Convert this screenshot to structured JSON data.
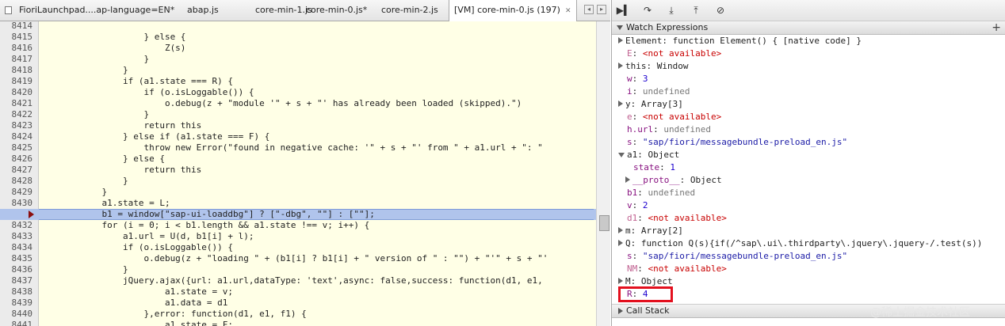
{
  "tabs": [
    {
      "label": "FioriLaunchpad....ap-language=EN*"
    },
    {
      "label": "abap.js"
    },
    {
      "label": "core-min-1.js"
    },
    {
      "label": "core-min-0.js*"
    },
    {
      "label": "core-min-2.js"
    },
    {
      "label": "[VM] core-min-0.js (197)",
      "close": "✕"
    }
  ],
  "editor": {
    "lines": [
      {
        "num": "8414",
        "code": ""
      },
      {
        "num": "8415",
        "code": "                    } else {"
      },
      {
        "num": "8416",
        "code": "                        Z(s)"
      },
      {
        "num": "8417",
        "code": "                    }"
      },
      {
        "num": "8418",
        "code": "                }"
      },
      {
        "num": "8419",
        "code": "                if (a1.state === R) {"
      },
      {
        "num": "8420",
        "code": "                    if (o.isLoggable()) {"
      },
      {
        "num": "8421",
        "code": "                        o.debug(z + \"module '\" + s + \"' has already been loaded (skipped).\")"
      },
      {
        "num": "8422",
        "code": "                    }"
      },
      {
        "num": "8423",
        "code": "                    return this"
      },
      {
        "num": "8424",
        "code": "                } else if (a1.state === F) {"
      },
      {
        "num": "8425",
        "code": "                    throw new Error(\"found in negative cache: '\" + s + \"' from \" + a1.url + \": \""
      },
      {
        "num": "8426",
        "code": "                } else {"
      },
      {
        "num": "8427",
        "code": "                    return this"
      },
      {
        "num": "8428",
        "code": "                }"
      },
      {
        "num": "8429",
        "code": "            }"
      },
      {
        "num": "8430",
        "code": "            a1.state = L;"
      },
      {
        "num": "",
        "code": "            b1 = window[\"sap-ui-loaddbg\"] ? [\"-dbg\", \"\"] : [\"\"];",
        "highlight": true
      },
      {
        "num": "8432",
        "code": "            for (i = 0; i < b1.length && a1.state !== v; i++) {"
      },
      {
        "num": "8433",
        "code": "                a1.url = U(d, b1[i] + l);"
      },
      {
        "num": "8434",
        "code": "                if (o.isLoggable()) {"
      },
      {
        "num": "8435",
        "code": "                    o.debug(z + \"loading \" + (b1[i] ? b1[i] + \" version of \" : \"\") + \"'\" + s + \"'"
      },
      {
        "num": "8436",
        "code": "                }"
      },
      {
        "num": "8437",
        "code": "                jQuery.ajax({url: a1.url,dataType: 'text',async: false,success: function(d1, e1,"
      },
      {
        "num": "8438",
        "code": "                        a1.state = v;"
      },
      {
        "num": "8439",
        "code": "                        a1.data = d1"
      },
      {
        "num": "8440",
        "code": "                    },error: function(d1, e1, f1) {"
      },
      {
        "num": "8441",
        "code": "                        a1.state = F;"
      },
      {
        "num": "",
        "code": ""
      }
    ]
  },
  "debugger": {
    "buttons": [
      "▶▍",
      "↷",
      "⤓",
      "⤒",
      "⊘"
    ],
    "watch_title": "Watch Expressions",
    "add": "+",
    "call_stack_title": "Call Stack"
  },
  "watch": [
    {
      "arrow": "closed",
      "key": "Element",
      "val": "function Element() { [native code] }",
      "vtype": "fn",
      "indent": 0
    },
    {
      "arrow": "none",
      "key": "E",
      "val": "<not available>",
      "vtype": "na",
      "indent": 0,
      "dim": true
    },
    {
      "arrow": "closed",
      "key": "this",
      "val": "Window",
      "vtype": "fn",
      "indent": 0
    },
    {
      "arrow": "none",
      "key": "w",
      "val": "3",
      "vtype": "num",
      "indent": 0
    },
    {
      "arrow": "none",
      "key": "i",
      "val": "undefined",
      "vtype": "undef",
      "indent": 0
    },
    {
      "arrow": "closed",
      "key": "y",
      "val": "Array[3]",
      "vtype": "fn",
      "indent": 0
    },
    {
      "arrow": "none",
      "key": "e",
      "val": "<not available>",
      "vtype": "na",
      "indent": 0,
      "dim": true
    },
    {
      "arrow": "none",
      "key": "h.url",
      "val": "undefined",
      "vtype": "undef",
      "indent": 0
    },
    {
      "arrow": "none",
      "key": "s",
      "val": "\"sap/fiori/messagebundle-preload_en.js\"",
      "vtype": "str",
      "indent": 0
    },
    {
      "arrow": "open",
      "key": "a1",
      "val": "Object",
      "vtype": "fn",
      "indent": 0
    },
    {
      "arrow": "none",
      "key": "state",
      "val": "1",
      "vtype": "num",
      "indent": 1
    },
    {
      "arrow": "closed",
      "key": "__proto__",
      "val": "Object",
      "vtype": "fn",
      "indent": 1
    },
    {
      "arrow": "none",
      "key": "b1",
      "val": "undefined",
      "vtype": "undef",
      "indent": 0
    },
    {
      "arrow": "none",
      "key": "v",
      "val": "2",
      "vtype": "num",
      "indent": 0
    },
    {
      "arrow": "none",
      "key": "d1",
      "val": "<not available>",
      "vtype": "na",
      "indent": 0,
      "dim": true
    },
    {
      "arrow": "closed",
      "key": "m",
      "val": "Array[2]",
      "vtype": "fn",
      "indent": 0
    },
    {
      "arrow": "closed",
      "key": "Q",
      "val": "function Q(s){if(/^sap\\.ui\\.thirdparty\\.jquery\\.jquery-/.test(s))",
      "vtype": "fn",
      "indent": 0
    },
    {
      "arrow": "none",
      "key": "s",
      "val": "\"sap/fiori/messagebundle-preload_en.js\"",
      "vtype": "str",
      "indent": 0
    },
    {
      "arrow": "none",
      "key": "NM",
      "val": "<not available>",
      "vtype": "na",
      "indent": 0,
      "dim": true
    },
    {
      "arrow": "closed",
      "key": "M",
      "val": "Object",
      "vtype": "fn",
      "indent": 0
    },
    {
      "arrow": "none",
      "key": "R",
      "val": "4",
      "vtype": "num",
      "indent": 0
    }
  ],
  "watermark": "@稀土掘金技术社区"
}
